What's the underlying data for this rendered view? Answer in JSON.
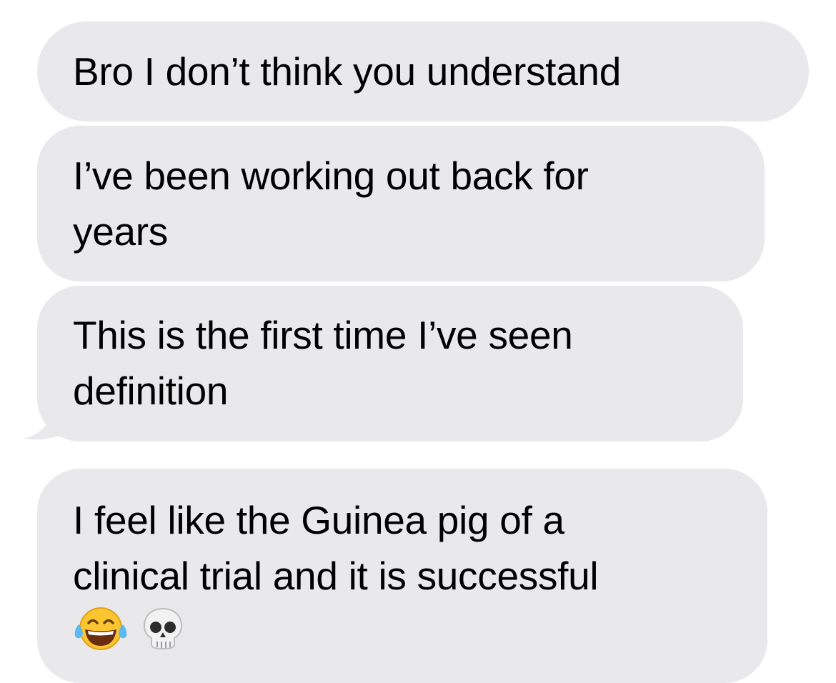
{
  "conversation": {
    "messages": [
      {
        "lines": [
          "Bro I don’t think you understand"
        ]
      },
      {
        "lines": [
          "I’ve been working out back for",
          "years"
        ]
      },
      {
        "lines": [
          "This is the first time I’ve seen",
          "definition"
        ]
      },
      {
        "lines": [
          "I feel like the Guinea pig of a",
          "clinical trial and it is successful"
        ],
        "emojis": [
          "joy-emoji",
          "skull-emoji"
        ]
      }
    ],
    "colors": {
      "bubble_background": "#e9e9eb",
      "text": "#000000",
      "page_background": "#ffffff"
    }
  }
}
